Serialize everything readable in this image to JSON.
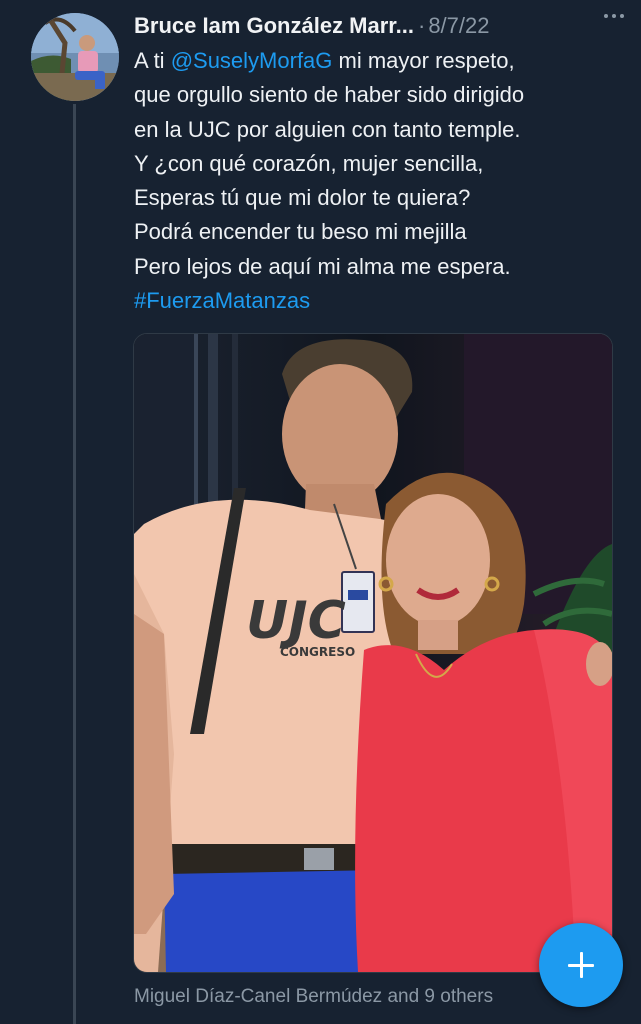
{
  "tweet": {
    "author_name": "Bruce Iam González Marr...",
    "separator": "·",
    "date": "8/7/22",
    "text_lines": [
      {
        "before": "A ti ",
        "mention": "@SuselyMorfaG",
        "after": " mi mayor respeto,"
      },
      {
        "text": "que orgullo siento de haber sido dirigido"
      },
      {
        "text": "en la UJC por alguien con tanto temple."
      },
      {
        "text": "Y ¿con qué corazón, mujer sencilla,"
      },
      {
        "text": "Esperas tú que mi dolor te quiera?"
      },
      {
        "text": "Podrá encender tu beso mi mejilla"
      },
      {
        "text": "Pero lejos de aquí mi alma me espera."
      }
    ],
    "hashtag": "#FuerzaMatanzas",
    "photo": {
      "shirt_print": "UJC",
      "shirt_subprint": "CONGRESO"
    },
    "liked_by": "Miguel Díaz-Canel Bermúdez and 9 others"
  },
  "icons": {
    "more": "more-horizontal-icon",
    "compose": "plus-icon"
  },
  "colors": {
    "background": "#172231",
    "link": "#1d9bf0",
    "secondary_text": "#8b98a5",
    "primary_text": "#eef1f4",
    "fab": "#1d9bf0"
  }
}
